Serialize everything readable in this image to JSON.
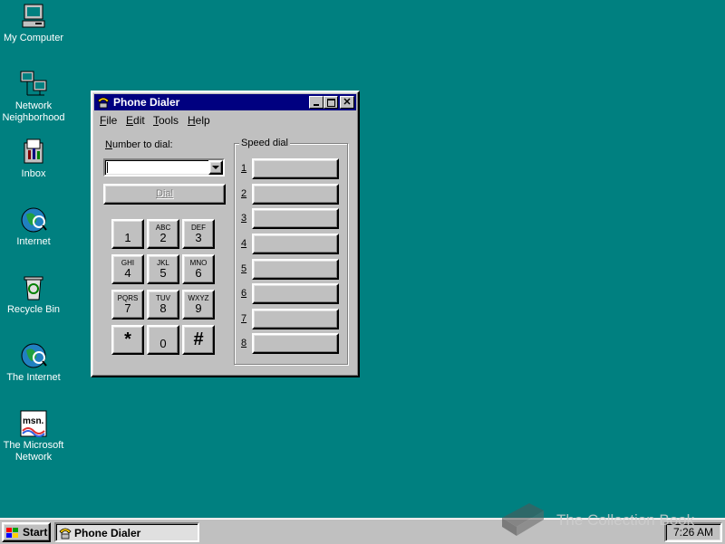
{
  "desktop": {
    "icons": [
      {
        "label_1": "My Computer",
        "label_2": ""
      },
      {
        "label_1": "Network",
        "label_2": "Neighborhood"
      },
      {
        "label_1": "Inbox",
        "label_2": ""
      },
      {
        "label_1": "Internet",
        "label_2": ""
      },
      {
        "label_1": "Recycle Bin",
        "label_2": ""
      },
      {
        "label_1": "The Internet",
        "label_2": ""
      },
      {
        "label_1": "The Microsoft",
        "label_2": "Network"
      }
    ],
    "msn_logo_text": "msn."
  },
  "window": {
    "title": "Phone Dialer",
    "menu": [
      {
        "mnemonic": "F",
        "rest": "ile"
      },
      {
        "mnemonic": "E",
        "rest": "dit"
      },
      {
        "mnemonic": "T",
        "rest": "ools"
      },
      {
        "mnemonic": "H",
        "rest": "elp"
      }
    ],
    "number_label_mnemonic": "N",
    "number_label_rest": "umber to dial:",
    "number_value": "",
    "dial_label": "Dial",
    "keypad": [
      {
        "sub": "",
        "main": "1"
      },
      {
        "sub": "ABC",
        "main": "2"
      },
      {
        "sub": "DEF",
        "main": "3"
      },
      {
        "sub": "GHI",
        "main": "4"
      },
      {
        "sub": "JKL",
        "main": "5"
      },
      {
        "sub": "MNO",
        "main": "6"
      },
      {
        "sub": "PQRS",
        "main": "7"
      },
      {
        "sub": "TUV",
        "main": "8"
      },
      {
        "sub": "WXYZ",
        "main": "9"
      },
      {
        "sub": "",
        "main": "*"
      },
      {
        "sub": "",
        "main": "0"
      },
      {
        "sub": "",
        "main": "#"
      }
    ],
    "speed_dial_title": "Speed dial",
    "speed_dial": [
      "1",
      "2",
      "3",
      "4",
      "5",
      "6",
      "7",
      "8"
    ]
  },
  "taskbar": {
    "start_label": "Start",
    "task_label": "Phone Dialer",
    "clock": "7:26 AM"
  },
  "watermark": "The Collection Book"
}
